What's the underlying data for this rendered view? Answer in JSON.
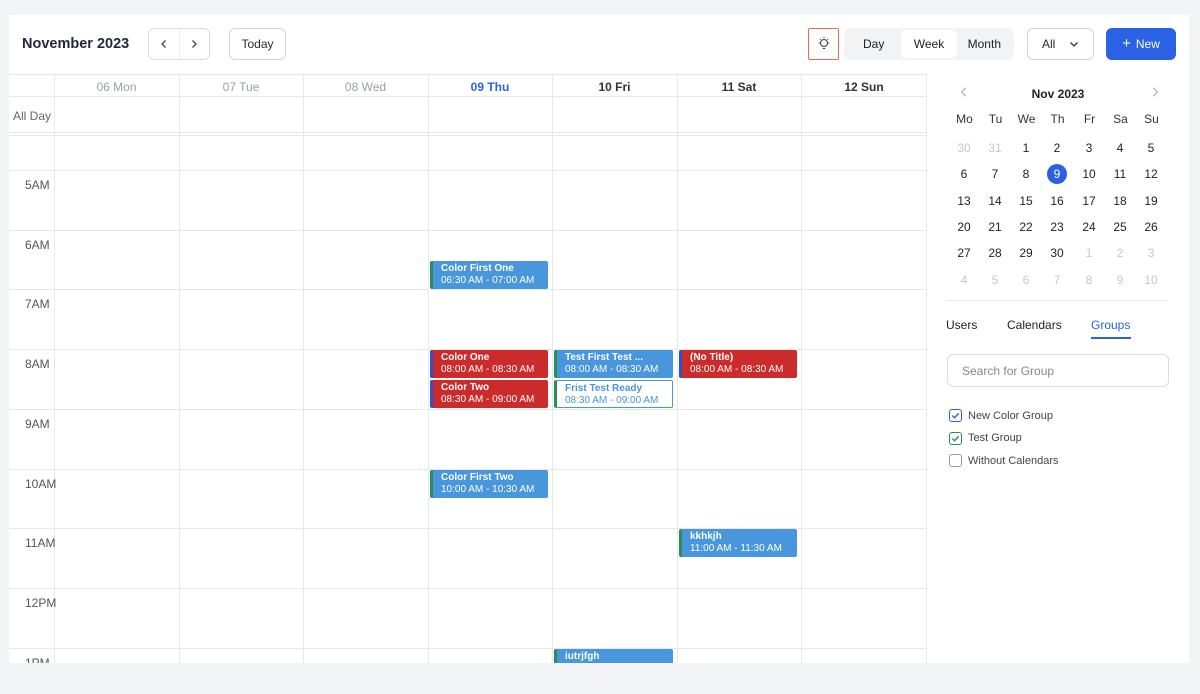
{
  "header": {
    "title": "November 2023",
    "today_label": "Today",
    "views": [
      "Day",
      "Week",
      "Month"
    ],
    "active_view": "Week",
    "filter_value": "All",
    "new_label": "New"
  },
  "week": {
    "allday_label": "All Day",
    "days": [
      {
        "label": "06 Mon",
        "state": "past"
      },
      {
        "label": "07 Tue",
        "state": "past"
      },
      {
        "label": "08 Wed",
        "state": "past"
      },
      {
        "label": "09 Thu",
        "state": "current"
      },
      {
        "label": "10 Fri",
        "state": "future"
      },
      {
        "label": "11 Sat",
        "state": "future"
      },
      {
        "label": "12 Sun",
        "state": "future"
      }
    ],
    "hours": [
      "5AM",
      "6AM",
      "7AM",
      "8AM",
      "9AM",
      "10AM",
      "11AM",
      "12PM",
      "1PM"
    ]
  },
  "events": [
    {
      "title": "Color First One",
      "time": "06:30 AM - 07:00 AM",
      "style": "blue"
    },
    {
      "title": "Color One",
      "time": "08:00 AM - 08:30 AM",
      "style": "red"
    },
    {
      "title": "Color Two",
      "time": "08:30 AM - 09:00 AM",
      "style": "red"
    },
    {
      "title": "Test First Test ...",
      "time": "08:00 AM - 08:30 AM",
      "style": "blue"
    },
    {
      "title": "Frist Test Ready",
      "time": "08:30 AM - 09:00 AM",
      "style": "outline"
    },
    {
      "title": "(No Title)",
      "time": "08:00 AM - 08:30 AM",
      "style": "red"
    },
    {
      "title": "Color First Two",
      "time": "10:00 AM - 10:30 AM",
      "style": "blue"
    },
    {
      "title": "kkhkjh",
      "time": "11:00 AM - 11:30 AM",
      "style": "blue"
    },
    {
      "title": "iutrjfgh",
      "time": "",
      "style": "blue"
    }
  ],
  "mini_calendar": {
    "title": "Nov 2023",
    "weekdays": [
      "Mo",
      "Tu",
      "We",
      "Th",
      "Fr",
      "Sa",
      "Su"
    ],
    "weeks": [
      [
        "30",
        "31",
        "1",
        "2",
        "3",
        "4",
        "5"
      ],
      [
        "6",
        "7",
        "8",
        "9",
        "10",
        "11",
        "12"
      ],
      [
        "13",
        "14",
        "15",
        "16",
        "17",
        "18",
        "19"
      ],
      [
        "20",
        "21",
        "22",
        "23",
        "24",
        "25",
        "26"
      ],
      [
        "27",
        "28",
        "29",
        "30",
        "1",
        "2",
        "3"
      ],
      [
        "4",
        "5",
        "6",
        "7",
        "8",
        "9",
        "10"
      ]
    ],
    "selected": "9"
  },
  "sidebar": {
    "tabs": [
      "Users",
      "Calendars",
      "Groups"
    ],
    "active_tab": "Groups",
    "search_placeholder": "Search for Group",
    "groups": [
      {
        "label": "New Color Group",
        "checked": true,
        "color": "#2b61e3"
      },
      {
        "label": "Test Group",
        "checked": true,
        "color": "#2e8b57"
      },
      {
        "label": "Without Calendars",
        "checked": false,
        "color": "#999999"
      }
    ]
  },
  "colors": {
    "accent": "#2b61e3",
    "event_blue": "#4896dc",
    "event_red": "#cc2b2b"
  }
}
